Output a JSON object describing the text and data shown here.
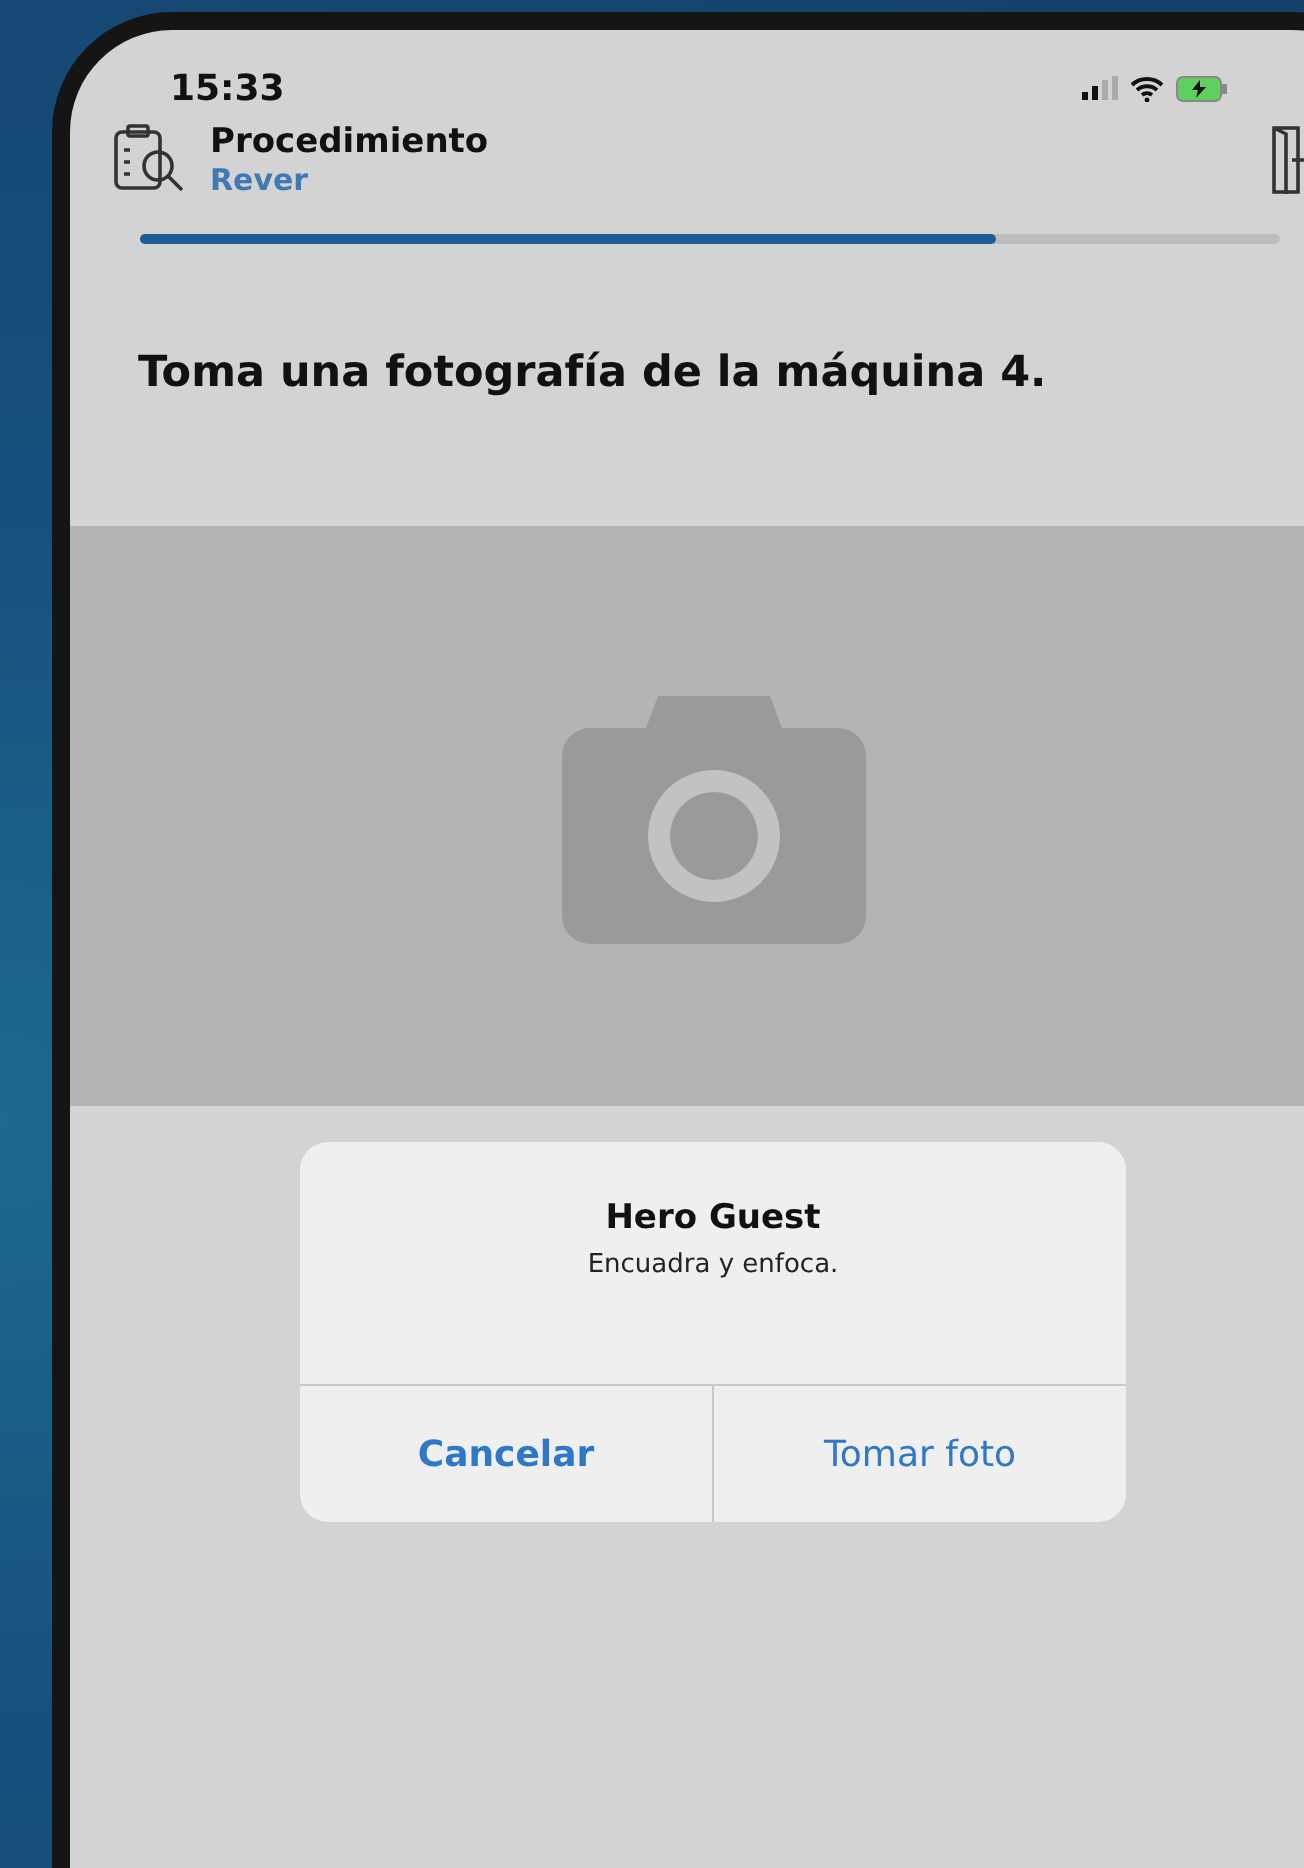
{
  "status_bar": {
    "time": "15:33"
  },
  "header": {
    "title": "Procedimiento",
    "subtitle": "Rever"
  },
  "progress": {
    "level": 0.75
  },
  "instruction": "Toma una fotografía de la máquina 4.",
  "camera_area": {
    "kind": "placeholder"
  },
  "alert": {
    "title": "Hero Guest",
    "message": "Encuadra y enfoca.",
    "buttons": [
      {
        "label": "Cancelar",
        "bold": true
      },
      {
        "label": "Tomar foto",
        "bold": false
      }
    ]
  }
}
